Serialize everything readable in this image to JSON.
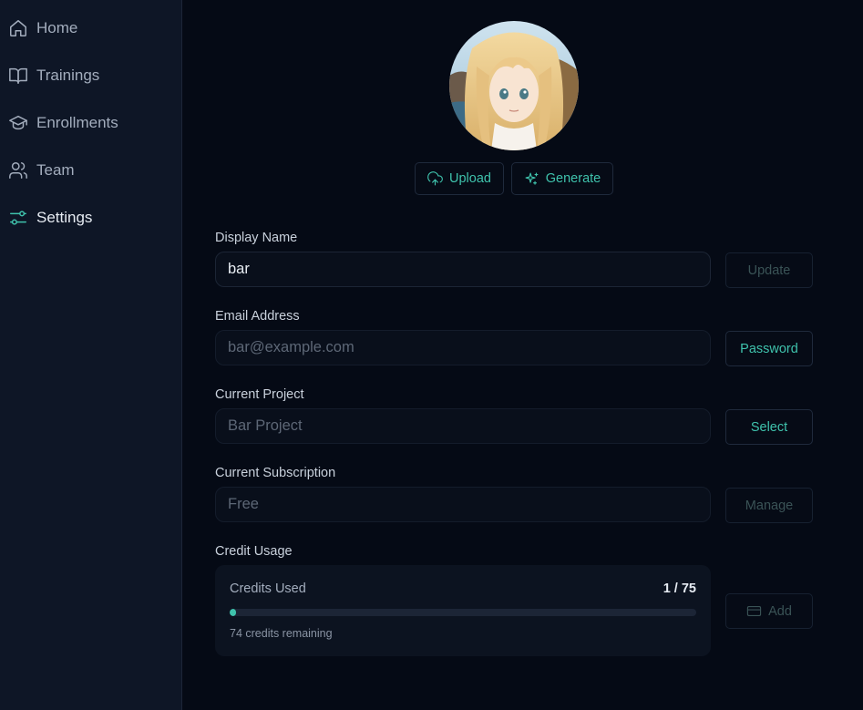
{
  "sidebar": {
    "items": [
      {
        "label": "Home",
        "icon": "home-icon"
      },
      {
        "label": "Trainings",
        "icon": "book-icon"
      },
      {
        "label": "Enrollments",
        "icon": "graduation-cap-icon"
      },
      {
        "label": "Team",
        "icon": "users-icon"
      },
      {
        "label": "Settings",
        "icon": "settings-sliders-icon",
        "active": true
      }
    ]
  },
  "profile": {
    "avatar_icon": "avatar-anime-portrait",
    "upload_label": "Upload",
    "generate_label": "Generate"
  },
  "form": {
    "display_name": {
      "label": "Display Name",
      "value": "bar",
      "action": "Update"
    },
    "email": {
      "label": "Email Address",
      "value": "bar@example.com",
      "action": "Password"
    },
    "project": {
      "label": "Current Project",
      "value": "Bar Project",
      "action": "Select"
    },
    "subscription": {
      "label": "Current Subscription",
      "value": "Free",
      "action": "Manage"
    },
    "credits": {
      "label": "Credit Usage",
      "title": "Credits Used",
      "used": 1,
      "total": 75,
      "count_text": "1 / 75",
      "remaining_text": "74 credits remaining",
      "action": "Add"
    }
  },
  "colors": {
    "accent": "#3fc2ac",
    "background": "#050a15",
    "sidebar": "#0e1626"
  }
}
